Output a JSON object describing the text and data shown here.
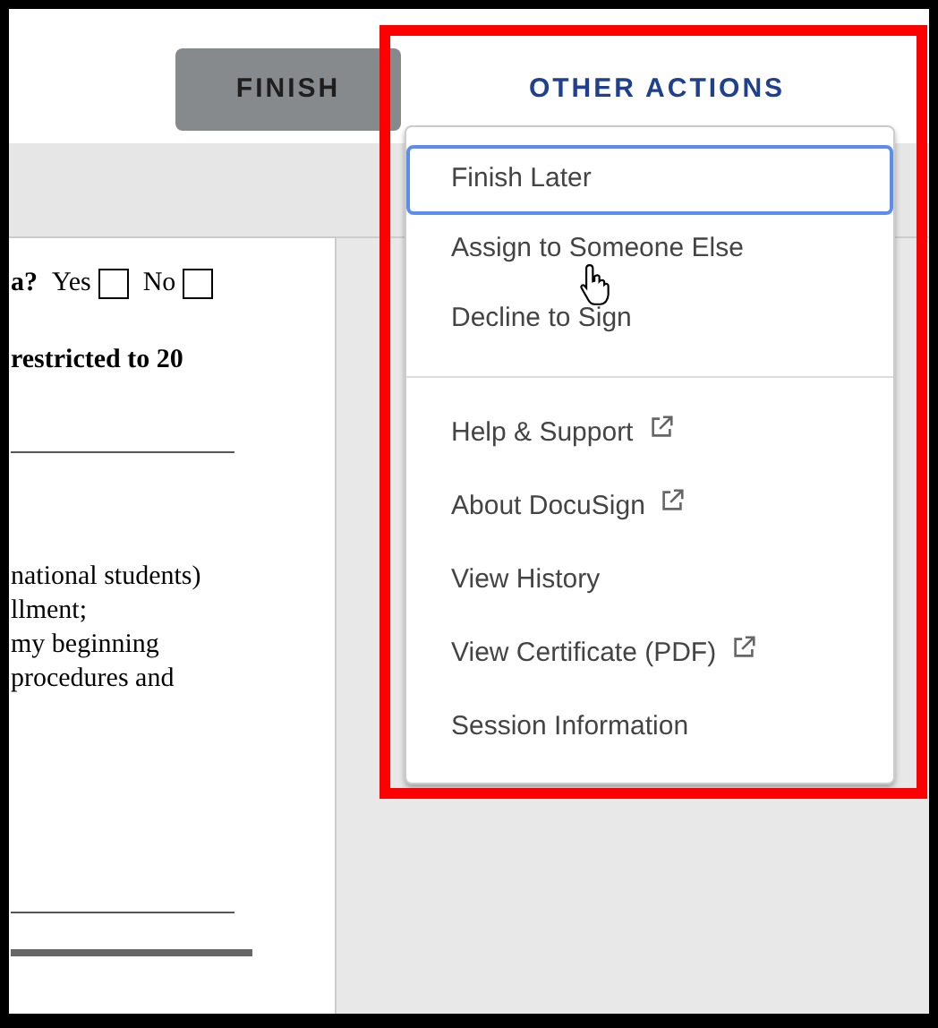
{
  "header": {
    "buttons": [
      {
        "label": "FINISH",
        "kind": "primary"
      },
      {
        "label": "OTHER ACTIONS",
        "kind": "menu"
      }
    ]
  },
  "document": {
    "lines": [
      {
        "kind": "question",
        "text": "a?",
        "options": [
          {
            "label": "Yes",
            "checked": false
          },
          {
            "label": "No",
            "checked": false
          }
        ]
      },
      {
        "kind": "bold",
        "text": "restricted to 20"
      },
      {
        "kind": "rule"
      },
      {
        "kind": "text",
        "text": "national students)"
      },
      {
        "kind": "text",
        "text": "llment;"
      },
      {
        "kind": "text",
        "text": "my beginning"
      },
      {
        "kind": "text",
        "text": "procedures and"
      },
      {
        "kind": "rule"
      },
      {
        "kind": "thick-rule"
      }
    ]
  },
  "menu": {
    "groups": [
      [
        {
          "label": "Finish Later",
          "external": false,
          "selected": true
        },
        {
          "label": "Assign to Someone Else",
          "external": false,
          "selected": false
        },
        {
          "label": "Decline to Sign",
          "external": false,
          "selected": false
        }
      ],
      [
        {
          "label": "Help & Support",
          "external": true,
          "selected": false
        },
        {
          "label": "About DocuSign",
          "external": true,
          "selected": false
        },
        {
          "label": "View History",
          "external": false,
          "selected": false
        },
        {
          "label": "View Certificate (PDF)",
          "external": true,
          "selected": false
        },
        {
          "label": "Session Information",
          "external": false,
          "selected": false
        }
      ]
    ]
  }
}
